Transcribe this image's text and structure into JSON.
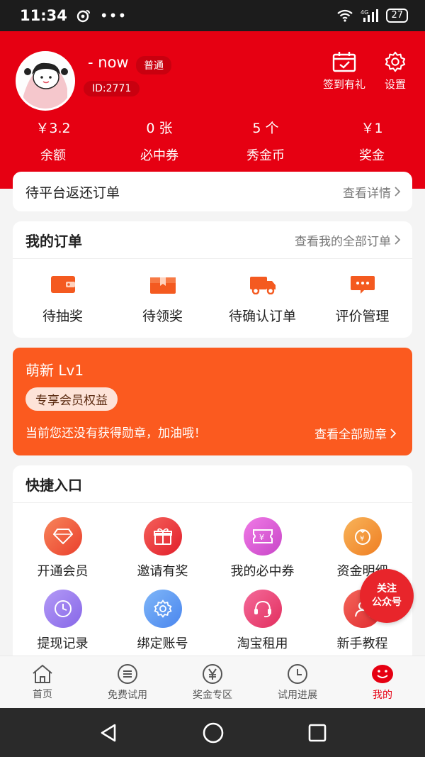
{
  "status_bar": {
    "time": "11:34",
    "battery": "27",
    "network": "4G"
  },
  "profile": {
    "username": "- now",
    "level_badge": "普通",
    "user_id": "ID:2771"
  },
  "header_actions": {
    "checkin_label": "签到有礼",
    "settings_label": "设置"
  },
  "stats": [
    {
      "value": "￥3.2",
      "label": "余额"
    },
    {
      "value": "0 张",
      "label": "必中券"
    },
    {
      "value": "5 个",
      "label": "秀金币"
    },
    {
      "value": "￥1",
      "label": "奖金"
    }
  ],
  "pending": {
    "title": "待平台返还订单",
    "more": "查看详情"
  },
  "orders": {
    "title": "我的订单",
    "more": "查看我的全部订单",
    "items": [
      {
        "label": "待抽奖",
        "icon": "wallet-icon"
      },
      {
        "label": "待领奖",
        "icon": "gift-box-icon"
      },
      {
        "label": "待确认订单",
        "icon": "truck-icon"
      },
      {
        "label": "评价管理",
        "icon": "comment-icon"
      }
    ]
  },
  "level": {
    "name": "萌新 Lv1",
    "perk": "专享会员权益",
    "message": "当前您还没有获得勋章，加油哦！",
    "more": "查看全部勋章"
  },
  "quick": {
    "title": "快捷入口",
    "items": [
      {
        "label": "开通会员",
        "icon": "diamond-icon",
        "color": "#f2553a"
      },
      {
        "label": "邀请有奖",
        "icon": "gift-icon",
        "color": "#ea3537"
      },
      {
        "label": "我的必中券",
        "icon": "ticket-icon",
        "color": "#e05bd4"
      },
      {
        "label": "资金明细",
        "icon": "money-bag-icon",
        "color": "#f29a34"
      },
      {
        "label": "提现记录",
        "icon": "clock-icon",
        "color": "#9b7cf0"
      },
      {
        "label": "绑定账号",
        "icon": "gear-icon",
        "color": "#5b9cf4"
      },
      {
        "label": "淘宝租用",
        "icon": "headset-icon",
        "color": "#ea3a6e"
      },
      {
        "label": "新手教程",
        "icon": "user-guide-icon",
        "color": "#ea3a40"
      }
    ]
  },
  "follow": {
    "line1": "关注",
    "line2": "公众号"
  },
  "tabs": [
    {
      "label": "首页",
      "icon": "home-icon"
    },
    {
      "label": "免费试用",
      "icon": "menu-circle-icon"
    },
    {
      "label": "奖金专区",
      "icon": "yen-circle-icon"
    },
    {
      "label": "试用进展",
      "icon": "clock-icon"
    },
    {
      "label": "我的",
      "icon": "smile-icon",
      "active": true
    }
  ],
  "colors": {
    "brand_red": "#e60012",
    "level_orange": "#fb5a1f"
  }
}
